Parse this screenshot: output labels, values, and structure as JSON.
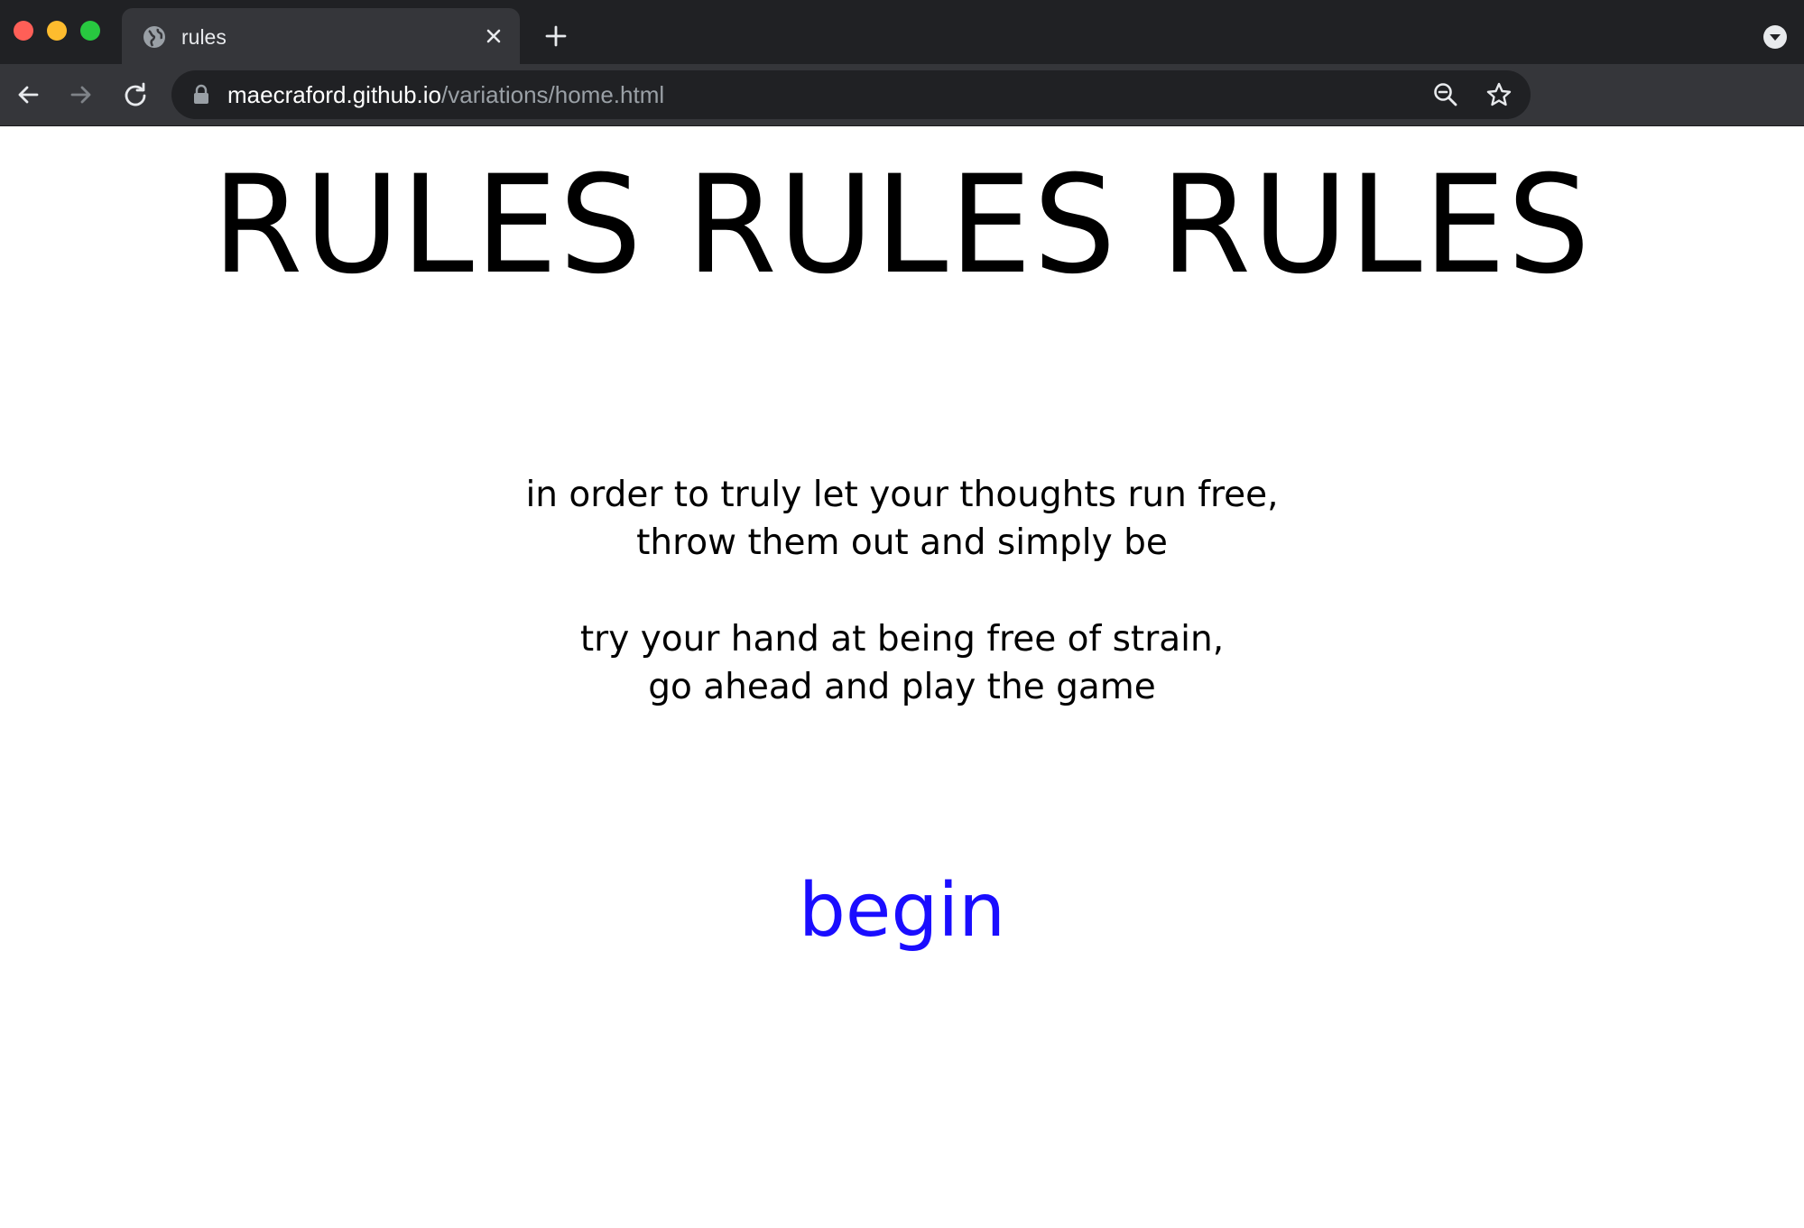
{
  "browser": {
    "tab": {
      "title": "rules",
      "favicon": "globe-icon"
    },
    "address_bar": {
      "host": "maecraford.github.io",
      "path": "/variations/home.html"
    },
    "icons": {
      "close_tab": "close-icon",
      "new_tab": "plus-icon",
      "tab_search": "chevron-down-icon",
      "back": "arrow-left-icon",
      "forward": "arrow-right-icon",
      "reload": "reload-icon",
      "lock": "lock-icon",
      "zoom": "zoom-out-icon",
      "bookmark": "star-icon"
    },
    "colors": {
      "traffic_red": "#ff5f57",
      "traffic_yellow": "#febc2e",
      "traffic_green": "#28c840"
    }
  },
  "page": {
    "title": "RULES RULES RULES",
    "poem": {
      "stanza1": [
        "in order to truly let your thoughts run free,",
        "throw them out and simply be"
      ],
      "stanza2": [
        "try your hand at being free of strain,",
        "go ahead and play the game"
      ]
    },
    "begin_label": "begin",
    "link_color": "#1a0dff"
  }
}
